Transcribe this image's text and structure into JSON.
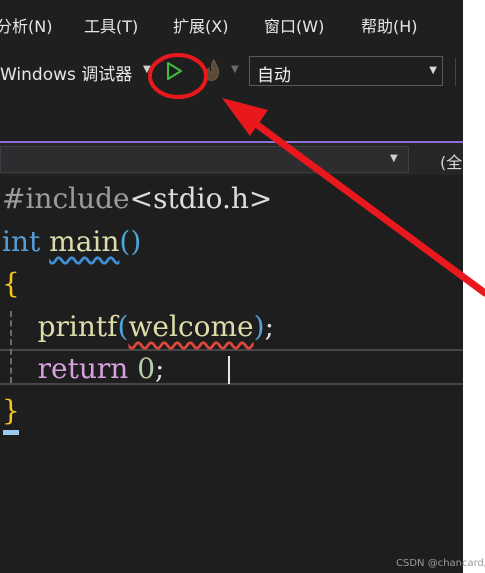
{
  "menubar": {
    "items": [
      "分析(N)",
      "工具(T)",
      "扩展(X)",
      "窗口(W)",
      "帮助(H)"
    ]
  },
  "toolbar": {
    "debugger_label": "Windows 调试器",
    "config_value": "自动"
  },
  "navbar": {
    "scope_text": "(全"
  },
  "editor": {
    "line1": {
      "preproc": "#include",
      "header": "<stdio.h>"
    },
    "line2": {
      "keyword": "int",
      "func": "main",
      "parens": "()"
    },
    "line3": {
      "brace_open": "{"
    },
    "line4": {
      "func": "printf",
      "paren_open": "(",
      "arg": "welcome",
      "paren_close": ")",
      "semi": ";"
    },
    "line5": {
      "keyword": "return",
      "value": "0",
      "semi": ";"
    },
    "line6": {
      "brace_close": "}"
    }
  },
  "watermark": "CSDN @chancard康",
  "colors": {
    "annotation_red": "#e8181c",
    "accent_purple": "#8b6fd6",
    "run_green": "#3fbf3f"
  },
  "icons": [
    "play-icon",
    "hot-reload-flame-icon",
    "chevron-down-icon"
  ]
}
